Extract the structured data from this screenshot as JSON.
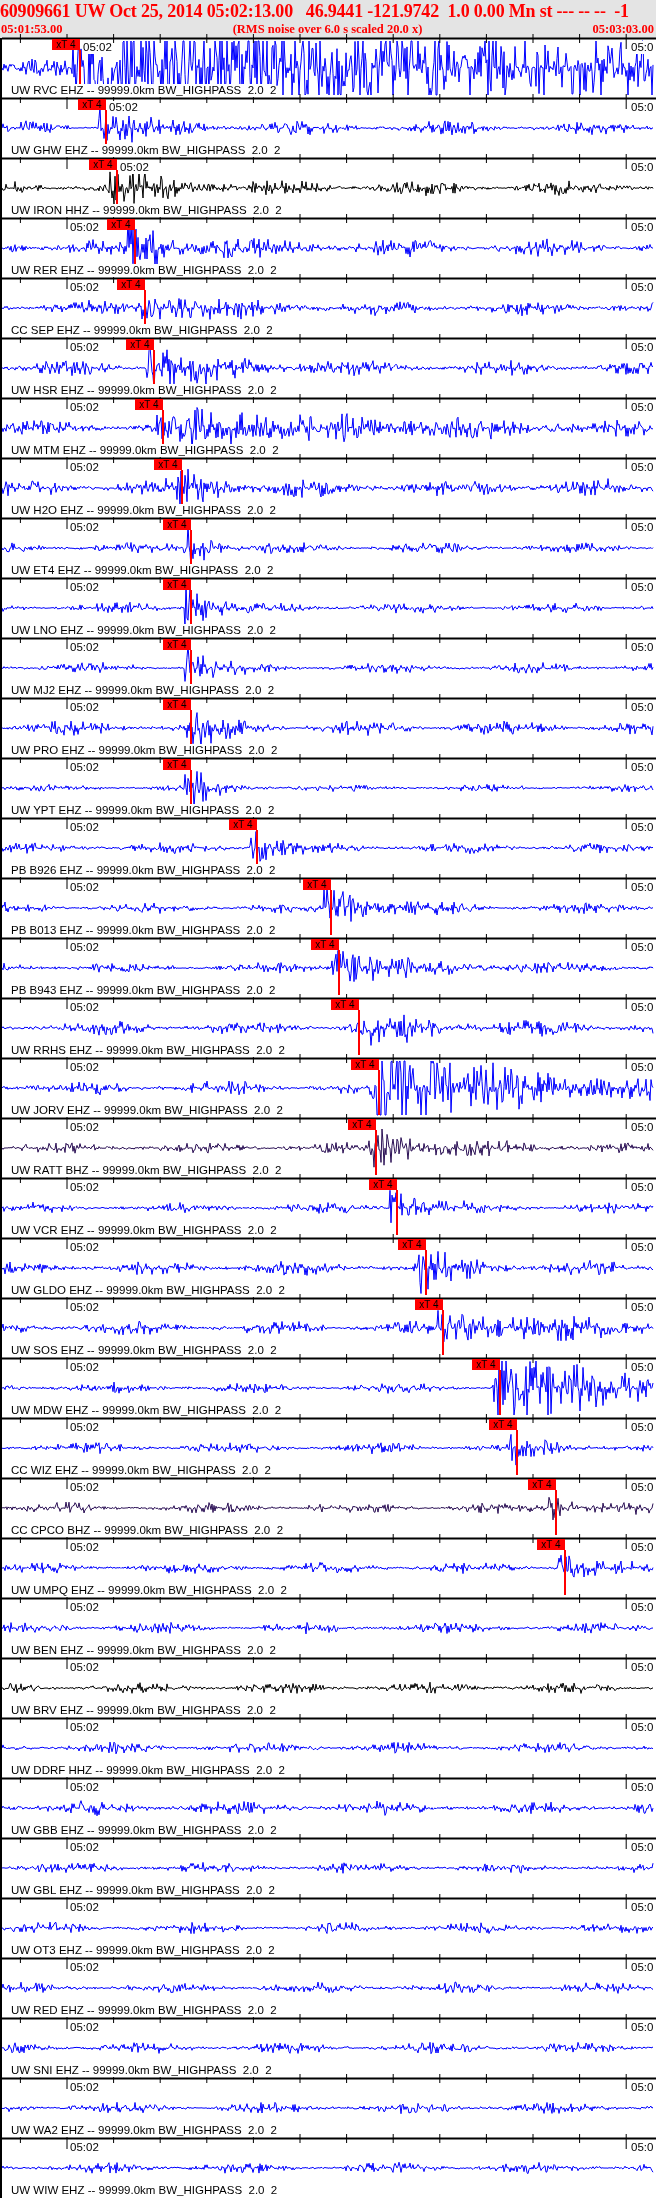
{
  "header": {
    "title": "60909661 UW Oct 25, 2014 05:02:13.00   46.9441 -121.9742  1.0 0.00 Mn st --- -- --  -1",
    "start_time": "05:01:53.00",
    "note": "(RMS noise over 6.0 s scaled 20.0 x)",
    "end_time": "05:03:03.00"
  },
  "traces": [
    {
      "label": "UW RVC EHZ -- 99999.0km BW_HIGHPASS  2.0  2",
      "color": "#0000ff",
      "start_tick": "05:02",
      "end_tick": "05:0",
      "pick": "xT 4"
    },
    {
      "label": "UW GHW EHZ -- 99999.0km BW_HIGHPASS  2.0  2",
      "color": "#0000ff",
      "start_tick": "05:02",
      "end_tick": "05:0",
      "pick": "xT 4"
    },
    {
      "label": "UW IRON HHZ -- 99999.0km BW_HIGHPASS  2.0  2",
      "color": "#000000",
      "start_tick": "05:02",
      "end_tick": "05:0",
      "pick": "xT 4"
    },
    {
      "label": "UW RER EHZ -- 99999.0km BW_HIGHPASS  2.0  2",
      "color": "#0000ff",
      "start_tick": "05:02",
      "end_tick": "05:0",
      "pick": "xT 4"
    },
    {
      "label": "CC SEP EHZ -- 99999.0km BW_HIGHPASS  2.0  2",
      "color": "#0000ff",
      "start_tick": "05:02",
      "end_tick": "05:0",
      "pick": "xT 4"
    },
    {
      "label": "UW HSR EHZ -- 99999.0km BW_HIGHPASS  2.0  2",
      "color": "#0000ff",
      "start_tick": "05:02",
      "end_tick": "05:0",
      "pick": "xT 4"
    },
    {
      "label": "UW MTM EHZ -- 99999.0km BW_HIGHPASS  2.0  2",
      "color": "#0000ff",
      "start_tick": "05:02",
      "end_tick": "05:0",
      "pick": "xT 4"
    },
    {
      "label": "UW H2O EHZ -- 99999.0km BW_HIGHPASS  2.0  2",
      "color": "#0000ff",
      "start_tick": "05:02",
      "end_tick": "05:0",
      "pick": "xT 4"
    },
    {
      "label": "UW ET4 EHZ -- 99999.0km BW_HIGHPASS  2.0  2",
      "color": "#0000ff",
      "start_tick": "05:02",
      "end_tick": "05:0",
      "pick": "xT 4"
    },
    {
      "label": "UW LNO EHZ -- 99999.0km BW_HIGHPASS  2.0  2",
      "color": "#0000ff",
      "start_tick": "05:02",
      "end_tick": "05:0",
      "pick": "xT 4"
    },
    {
      "label": "UW MJ2 EHZ -- 99999.0km BW_HIGHPASS  2.0  2",
      "color": "#0000ff",
      "start_tick": "05:02",
      "end_tick": "05:0",
      "pick": "xT 4"
    },
    {
      "label": "UW PRO EHZ -- 99999.0km BW_HIGHPASS  2.0  2",
      "color": "#0000ff",
      "start_tick": "05:02",
      "end_tick": "05:0",
      "pick": "xT 4"
    },
    {
      "label": "UW YPT EHZ -- 99999.0km BW_HIGHPASS  2.0  2",
      "color": "#0000ff",
      "start_tick": "05:02",
      "end_tick": "05:0",
      "pick": "xT 4"
    },
    {
      "label": "PB B926 EHZ -- 99999.0km BW_HIGHPASS  2.0  2",
      "color": "#0000ff",
      "start_tick": "05:02",
      "end_tick": "05:0",
      "pick": "xT 4"
    },
    {
      "label": "PB B013 EHZ -- 99999.0km BW_HIGHPASS  2.0  2",
      "color": "#0000ff",
      "start_tick": "05:02",
      "end_tick": "05:0",
      "pick": "xT 4"
    },
    {
      "label": "PB B943 EHZ -- 99999.0km BW_HIGHPASS  2.0  2",
      "color": "#0000ff",
      "start_tick": "05:02",
      "end_tick": "05:0",
      "pick": "xT 4"
    },
    {
      "label": "UW RRHS EHZ -- 99999.0km BW_HIGHPASS  2.0  2",
      "color": "#0000ff",
      "start_tick": "05:02",
      "end_tick": "05:0",
      "pick": "xT 4"
    },
    {
      "label": "UW JORV EHZ -- 99999.0km BW_HIGHPASS  2.0  2",
      "color": "#0000ff",
      "start_tick": "05:02",
      "end_tick": "05:0",
      "pick": "xT 4"
    },
    {
      "label": "UW RATT BHZ -- 99999.0km BW_HIGHPASS  2.0  2",
      "color": "#2b1055",
      "start_tick": "05:02",
      "end_tick": "05:0",
      "pick": "xT 4"
    },
    {
      "label": "UW VCR EHZ -- 99999.0km BW_HIGHPASS  2.0  2",
      "color": "#0000ff",
      "start_tick": "05:02",
      "end_tick": "05:0",
      "pick": "xT 4"
    },
    {
      "label": "UW GLDO EHZ -- 99999.0km BW_HIGHPASS  2.0  2",
      "color": "#0000ff",
      "start_tick": "05:02",
      "end_tick": "05:0",
      "pick": "xT 4"
    },
    {
      "label": "UW SOS EHZ -- 99999.0km BW_HIGHPASS  2.0  2",
      "color": "#0000ff",
      "start_tick": "05:02",
      "end_tick": "05:0",
      "pick": "xT 4"
    },
    {
      "label": "UW MDW EHZ -- 99999.0km BW_HIGHPASS  2.0  2",
      "color": "#0000ff",
      "start_tick": "05:02",
      "end_tick": "05:0",
      "pick": "xT 4"
    },
    {
      "label": "CC WIZ EHZ -- 99999.0km BW_HIGHPASS  2.0  2",
      "color": "#0000ff",
      "start_tick": "05:02",
      "end_tick": "05:0",
      "pick": "xT 4"
    },
    {
      "label": "CC CPCO BHZ -- 99999.0km BW_HIGHPASS  2.0  2",
      "color": "#2b1055",
      "start_tick": "05:02",
      "end_tick": "05:0",
      "pick": "xT 4"
    },
    {
      "label": "UW UMPQ EHZ -- 99999.0km BW_HIGHPASS  2.0  2",
      "color": "#0000ff",
      "start_tick": "05:02",
      "end_tick": "05:0",
      "pick": "xT 4"
    },
    {
      "label": "UW BEN EHZ -- 99999.0km BW_HIGHPASS  2.0  2",
      "color": "#0000ff",
      "start_tick": "05:02",
      "end_tick": "05:0"
    },
    {
      "label": "UW BRV EHZ -- 99999.0km BW_HIGHPASS  2.0  2",
      "color": "#000000",
      "start_tick": "05:02",
      "end_tick": "05:0"
    },
    {
      "label": "UW DDRF HHZ -- 99999.0km BW_HIGHPASS  2.0  2",
      "color": "#0000ff",
      "start_tick": "05:02",
      "end_tick": "05:0"
    },
    {
      "label": "UW GBB EHZ -- 99999.0km BW_HIGHPASS  2.0  2",
      "color": "#0000ff",
      "start_tick": "05:02",
      "end_tick": "05:0"
    },
    {
      "label": "UW GBL EHZ -- 99999.0km BW_HIGHPASS  2.0  2",
      "color": "#0000ff",
      "start_tick": "05:02",
      "end_tick": "05:0"
    },
    {
      "label": "UW OT3 EHZ -- 99999.0km BW_HIGHPASS  2.0  2",
      "color": "#0000ff",
      "start_tick": "05:02",
      "end_tick": "05:0"
    },
    {
      "label": "UW RED EHZ -- 99999.0km BW_HIGHPASS  2.0  2",
      "color": "#0000ff",
      "start_tick": "05:02",
      "end_tick": "05:0"
    },
    {
      "label": "UW SNI EHZ -- 99999.0km BW_HIGHPASS  2.0  2",
      "color": "#0000ff",
      "start_tick": "05:02",
      "end_tick": "05:0"
    },
    {
      "label": "UW WA2 EHZ -- 99999.0km BW_HIGHPASS  2.0  2",
      "color": "#0000ff",
      "start_tick": "05:02",
      "end_tick": "05:0"
    },
    {
      "label": "UW WIW EHZ -- 99999.0km BW_HIGHPASS  2.0  2",
      "color": "#0000ff",
      "start_tick": "05:02",
      "end_tick": "05:0"
    }
  ]
}
